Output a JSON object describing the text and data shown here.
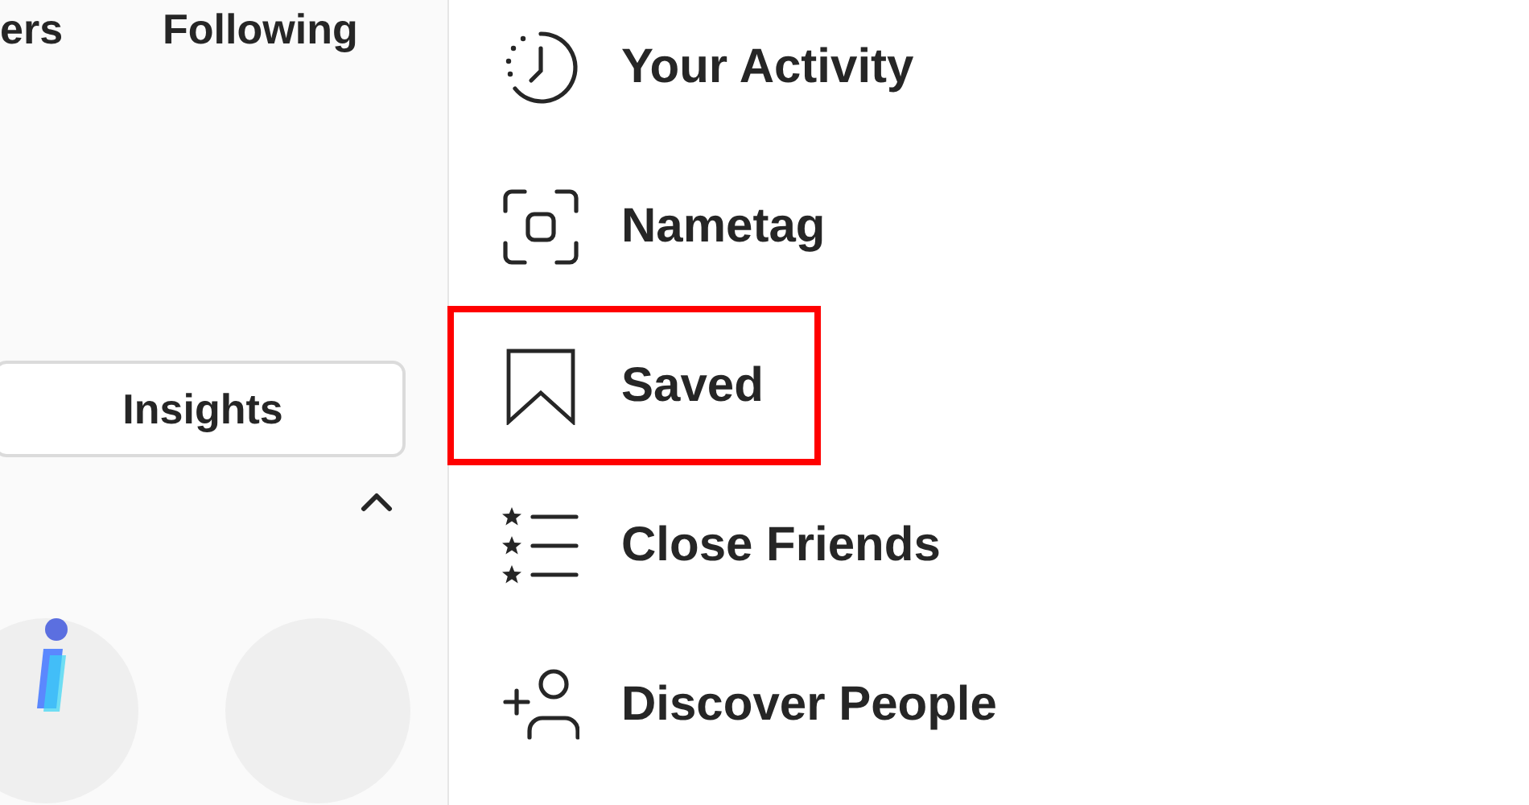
{
  "profile_panel": {
    "stats": [
      "ers",
      "Following"
    ],
    "insights_button": "Insights"
  },
  "menu": [
    {
      "kind": "activity",
      "label": "Your Activity",
      "highlighted": false
    },
    {
      "kind": "nametag",
      "label": "Nametag",
      "highlighted": false
    },
    {
      "kind": "saved",
      "label": "Saved",
      "highlighted": true
    },
    {
      "kind": "close-friends",
      "label": "Close Friends",
      "highlighted": false
    },
    {
      "kind": "discover",
      "label": "Discover People",
      "highlighted": false
    }
  ]
}
